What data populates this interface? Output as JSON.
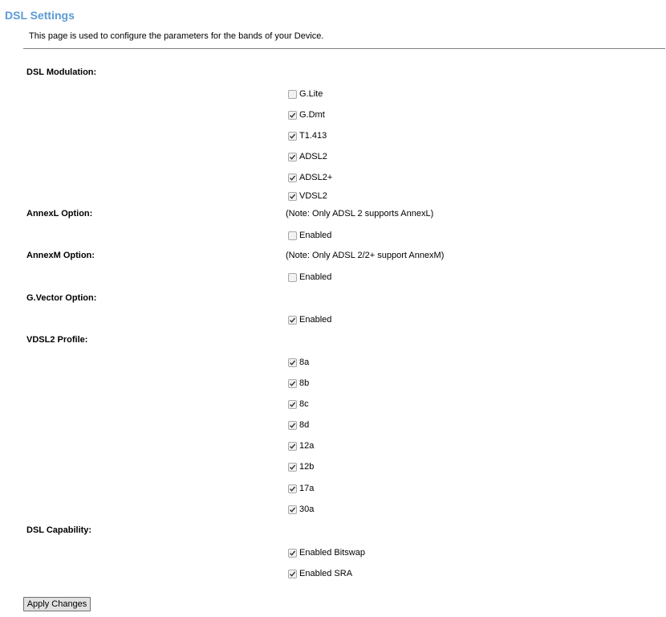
{
  "page": {
    "title": "DSL Settings",
    "subtitle": "This page is used to configure the parameters for the bands of your Device."
  },
  "modulation": {
    "label": "DSL Modulation:",
    "options": [
      {
        "label": "G.Lite",
        "checked": false
      },
      {
        "label": "G.Dmt",
        "checked": true
      },
      {
        "label": "T1.413",
        "checked": true
      },
      {
        "label": "ADSL2",
        "checked": true
      },
      {
        "label": "ADSL2+",
        "checked": true
      },
      {
        "label": "VDSL2",
        "checked": true
      }
    ]
  },
  "annexl": {
    "label": "AnnexL Option:",
    "note": "(Note: Only ADSL 2 supports AnnexL)",
    "option": {
      "label": "Enabled",
      "checked": false
    }
  },
  "annexm": {
    "label": "AnnexM Option:",
    "note": "(Note: Only ADSL 2/2+ support AnnexM)",
    "option": {
      "label": "Enabled",
      "checked": false
    }
  },
  "gvector": {
    "label": "G.Vector Option:",
    "option": {
      "label": "Enabled",
      "checked": true
    }
  },
  "vdsl2_profile": {
    "label": "VDSL2 Profile:",
    "options": [
      {
        "label": "8a",
        "checked": true
      },
      {
        "label": "8b",
        "checked": true
      },
      {
        "label": "8c",
        "checked": true
      },
      {
        "label": "8d",
        "checked": true
      },
      {
        "label": "12a",
        "checked": true
      },
      {
        "label": "12b",
        "checked": true
      },
      {
        "label": "17a",
        "checked": true
      },
      {
        "label": "30a",
        "checked": true
      }
    ]
  },
  "capability": {
    "label": "DSL Capability:",
    "options": [
      {
        "label": "Enabled Bitswap",
        "checked": true
      },
      {
        "label": "Enabled SRA",
        "checked": true
      }
    ]
  },
  "apply_button": {
    "label": "Apply Changes"
  }
}
